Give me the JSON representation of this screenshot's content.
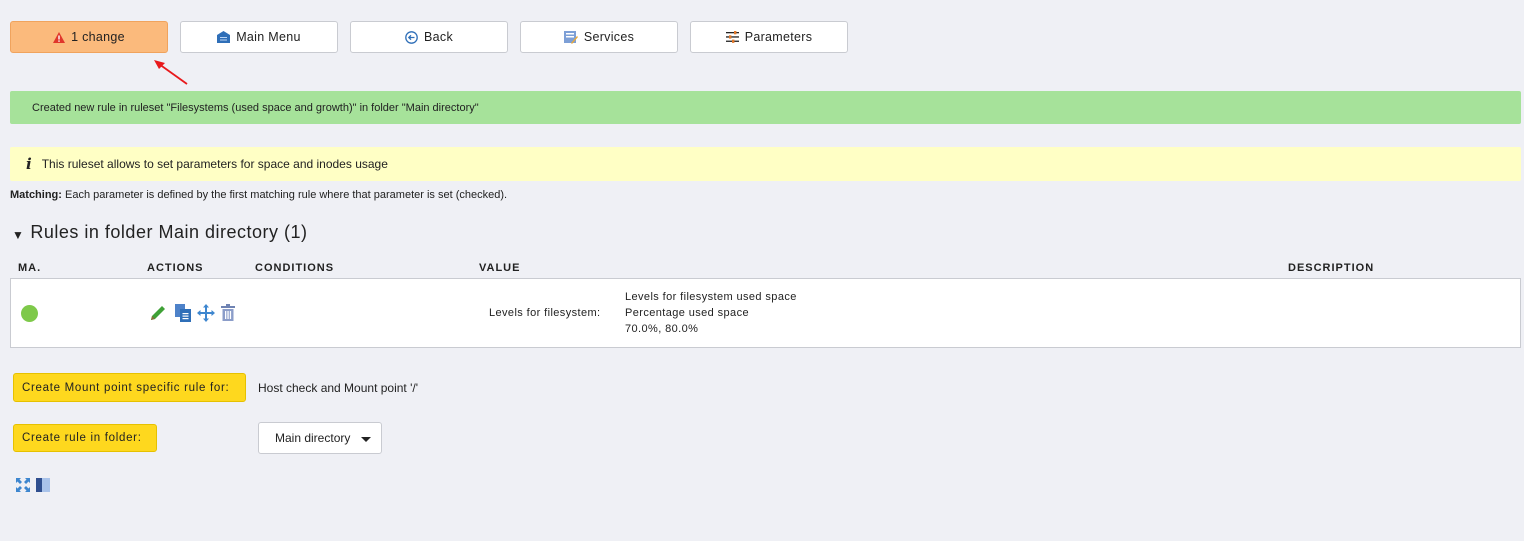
{
  "toolbar": {
    "change_label": "1 change",
    "main_menu_label": "Main Menu",
    "back_label": "Back",
    "services_label": "Services",
    "parameters_label": "Parameters"
  },
  "messages": {
    "success": "Created new rule in ruleset \"Filesystems (used space and growth)\" in folder \"Main directory\"",
    "info_icon": "i",
    "info": "This ruleset allows to set parameters for space and inodes usage",
    "matching_label": "Matching:",
    "matching_text": "Each parameter is defined by the first matching rule where that parameter is set (checked)."
  },
  "section": {
    "title": "Rules in folder Main directory (1)",
    "columns": {
      "ma": "MA.",
      "actions": "ACTIONS",
      "conditions": "CONDITIONS",
      "value": "VALUE",
      "description": "DESCRIPTION"
    }
  },
  "rule": {
    "status_color": "#7ec94a",
    "value_label": "Levels for filesystem:",
    "value_lines": [
      "Levels for filesystem used space",
      "Percentage used space",
      "70.0%, 80.0%"
    ],
    "actions": [
      "edit-icon",
      "clone-icon",
      "move-icon",
      "delete-icon"
    ]
  },
  "create": {
    "specific_label": "Create Mount point specific rule for:",
    "specific_target": "Host check and Mount point '/'",
    "folder_label": "Create rule in folder:",
    "folder_value": "Main directory"
  },
  "colors": {
    "change_button": "#fbba7c",
    "success_bg": "#a6e29a",
    "info_bg": "#ffffc5",
    "create_button": "#fed81e"
  }
}
